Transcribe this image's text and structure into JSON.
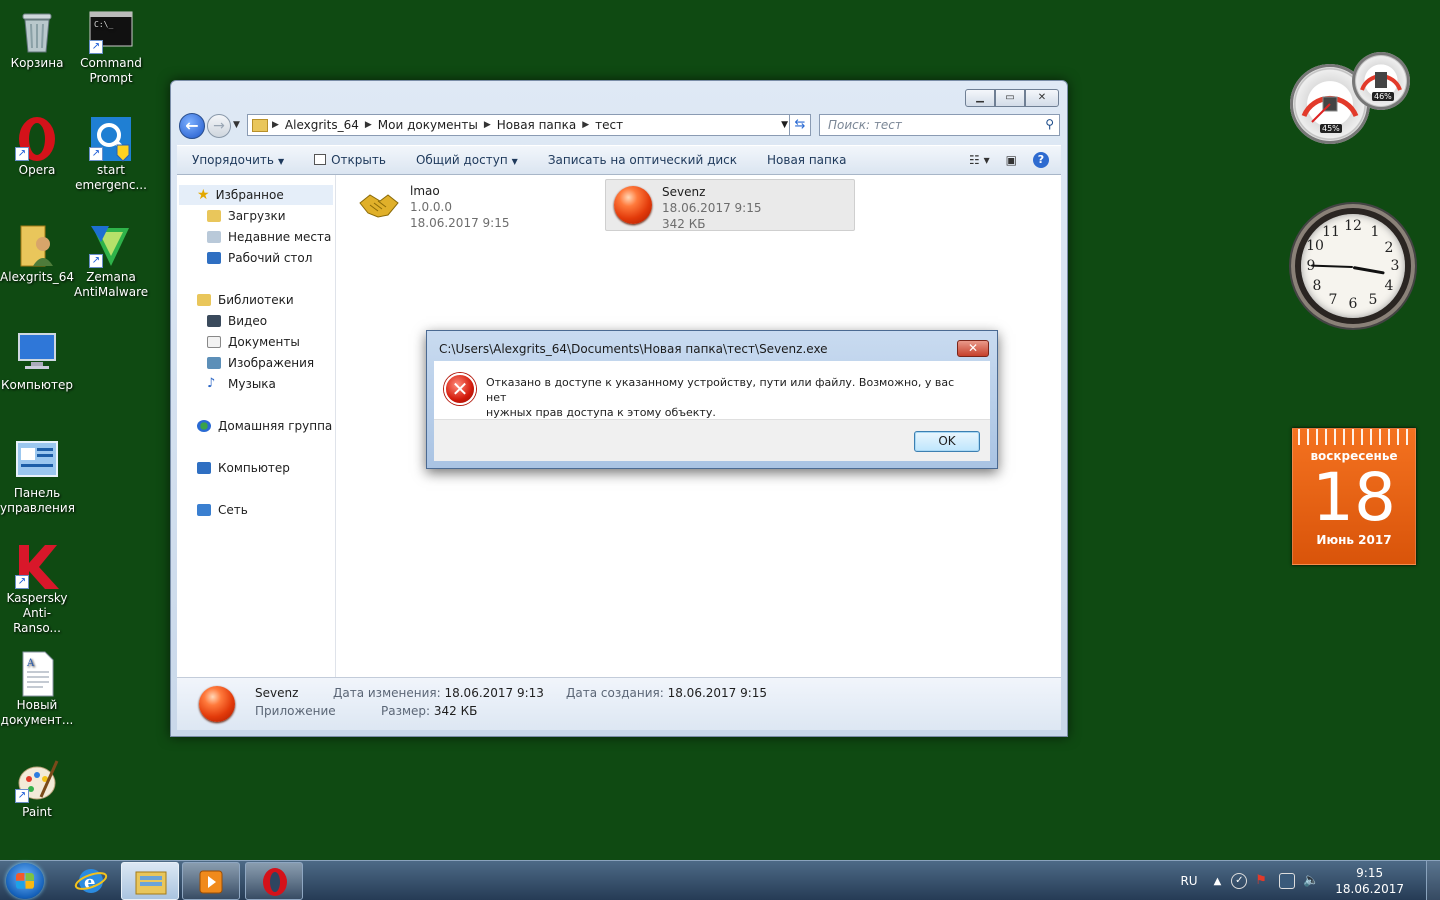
{
  "desktop": {
    "icons": [
      {
        "label": "Корзина",
        "icon": "recycle-bin-icon"
      },
      {
        "label": "Command Prompt",
        "icon": "command-prompt-icon"
      },
      {
        "label": "Opera",
        "icon": "opera-icon"
      },
      {
        "label": "start emergenc...",
        "icon": "start-emergency-icon"
      },
      {
        "label": "Alexgrits_64",
        "icon": "user-folder-icon"
      },
      {
        "label": "Zemana AntiMalware",
        "icon": "zemana-icon"
      },
      {
        "label": "Компьютер",
        "icon": "computer-icon"
      },
      {
        "label": "Панель управления",
        "icon": "control-panel-icon"
      },
      {
        "label": "Kaspersky Anti-Ranso...",
        "icon": "kaspersky-icon"
      },
      {
        "label": "Новый документ...",
        "icon": "document-icon"
      },
      {
        "label": "Paint",
        "icon": "paint-icon"
      }
    ]
  },
  "gadgets": {
    "meter": {
      "cpu": "45%",
      "ram": "46%"
    },
    "clock": {
      "numbers": [
        "12",
        "1",
        "2",
        "3",
        "4",
        "5",
        "6",
        "7",
        "8",
        "9",
        "10",
        "11"
      ]
    },
    "calendar": {
      "weekday": "воскресенье",
      "day": "18",
      "month": "Июнь 2017"
    }
  },
  "explorer": {
    "address": {
      "segments": [
        "Alexgrits_64",
        "Мои документы",
        "Новая папка",
        "тест"
      ]
    },
    "search_placeholder": "Поиск: тест",
    "commands": {
      "organize": "Упорядочить",
      "open": "Открыть",
      "share": "Общий доступ",
      "burn": "Записать на оптический диск",
      "new_folder": "Новая папка"
    },
    "nav": {
      "favorites": "Избранное",
      "downloads": "Загрузки",
      "recent": "Недавние места",
      "desktop": "Рабочий стол",
      "libraries": "Библиотеки",
      "video": "Видео",
      "documents": "Документы",
      "images": "Изображения",
      "music": "Музыка",
      "homegroup": "Домашняя группа",
      "computer": "Компьютер",
      "network": "Сеть"
    },
    "files": [
      {
        "name": "lmao",
        "line2": "1.0.0.0",
        "line3": "18.06.2017 9:15",
        "icon": "handshake-icon"
      },
      {
        "name": "Sevenz",
        "line2": "18.06.2017 9:15",
        "line3": "342 КБ",
        "icon": "red-ball-icon"
      }
    ],
    "details": {
      "name": "Sevenz",
      "type": "Приложение",
      "modified_label": "Дата изменения:",
      "modified_value": "18.06.2017 9:13",
      "size_label": "Размер:",
      "size_value": "342 КБ",
      "created_label": "Дата создания:",
      "created_value": "18.06.2017 9:15"
    }
  },
  "dialog": {
    "title": "C:\\Users\\Alexgrits_64\\Documents\\Новая папка\\тест\\Sevenz.exe",
    "message_line1": "Отказано в доступе к указанному устройству, пути или файлу. Возможно,  у вас нет",
    "message_line2": "нужных прав доступа к этому объекту.",
    "ok": "OK"
  },
  "taskbar": {
    "lang": "RU",
    "time": "9:15",
    "date": "18.06.2017"
  }
}
